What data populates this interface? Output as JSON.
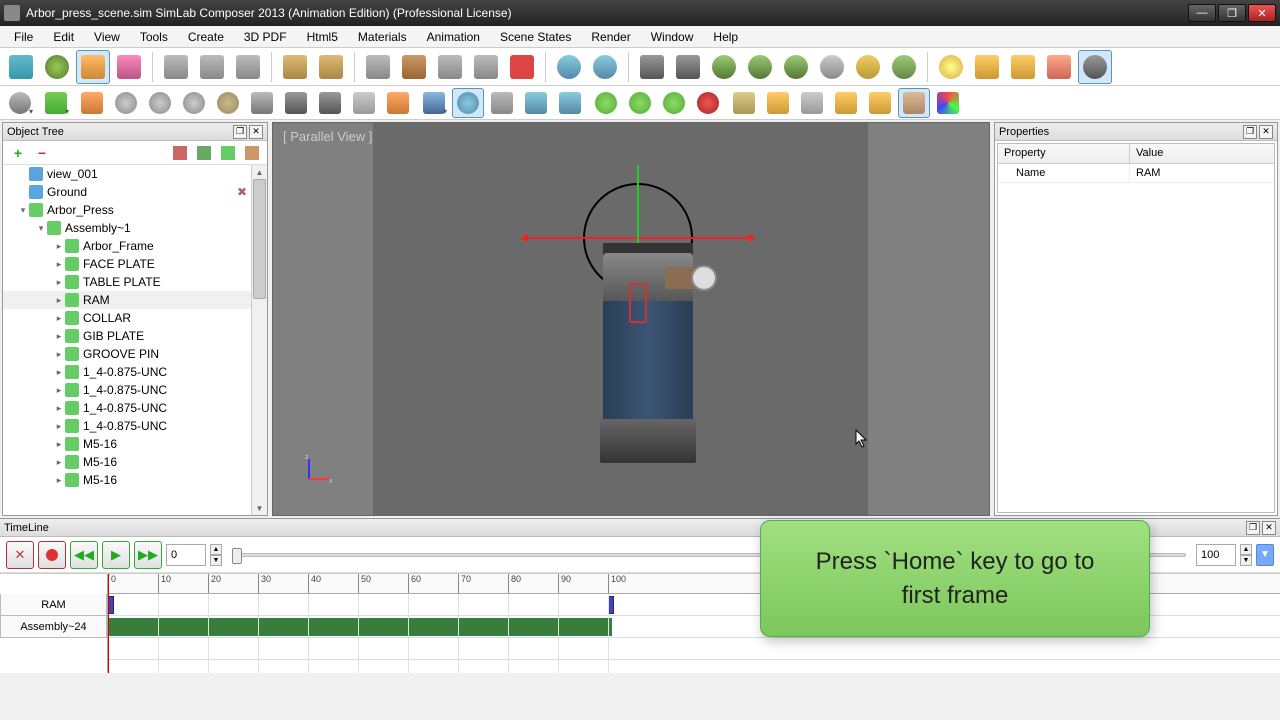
{
  "window": {
    "title": "Arbor_press_scene.sim SimLab Composer 2013 (Animation Edition)    (Professional License)"
  },
  "menu": [
    "File",
    "Edit",
    "View",
    "Tools",
    "Create",
    "3D PDF",
    "Html5",
    "Materials",
    "Animation",
    "Scene States",
    "Render",
    "Window",
    "Help"
  ],
  "panels": {
    "objectTree": "Object Tree",
    "properties": "Properties",
    "timeline": "TimeLine"
  },
  "tree": {
    "items": [
      {
        "depth": 0,
        "expander": "",
        "icon": "#5aa5e0",
        "label": "view_001"
      },
      {
        "depth": 0,
        "expander": "",
        "icon": "#5aa5e0",
        "label": "Ground",
        "extra": true
      },
      {
        "depth": 0,
        "expander": "▾",
        "icon": "#6c6",
        "label": "Arbor_Press"
      },
      {
        "depth": 1,
        "expander": "▾",
        "icon": "#6c6",
        "label": "Assembly~1"
      },
      {
        "depth": 2,
        "expander": "▸",
        "icon": "#6c6",
        "label": "Arbor_Frame"
      },
      {
        "depth": 2,
        "expander": "▸",
        "icon": "#6c6",
        "label": "FACE PLATE"
      },
      {
        "depth": 2,
        "expander": "▸",
        "icon": "#6c6",
        "label": "TABLE PLATE"
      },
      {
        "depth": 2,
        "expander": "▸",
        "icon": "#6c6",
        "label": "RAM",
        "selected": true
      },
      {
        "depth": 2,
        "expander": "▸",
        "icon": "#6c6",
        "label": "COLLAR"
      },
      {
        "depth": 2,
        "expander": "▸",
        "icon": "#6c6",
        "label": "GIB PLATE"
      },
      {
        "depth": 2,
        "expander": "▸",
        "icon": "#6c6",
        "label": "GROOVE PIN"
      },
      {
        "depth": 2,
        "expander": "▸",
        "icon": "#6c6",
        "label": "1_4-0.875-UNC"
      },
      {
        "depth": 2,
        "expander": "▸",
        "icon": "#6c6",
        "label": "1_4-0.875-UNC"
      },
      {
        "depth": 2,
        "expander": "▸",
        "icon": "#6c6",
        "label": "1_4-0.875-UNC"
      },
      {
        "depth": 2,
        "expander": "▸",
        "icon": "#6c6",
        "label": "1_4-0.875-UNC"
      },
      {
        "depth": 2,
        "expander": "▸",
        "icon": "#6c6",
        "label": "M5-16"
      },
      {
        "depth": 2,
        "expander": "▸",
        "icon": "#6c6",
        "label": "M5-16"
      },
      {
        "depth": 2,
        "expander": "▸",
        "icon": "#6c6",
        "label": "M5-16"
      }
    ]
  },
  "viewport": {
    "viewLabel": "[ Parallel View ]"
  },
  "properties": {
    "headProperty": "Property",
    "headValue": "Value",
    "rows": [
      {
        "name": "Name",
        "value": "RAM"
      }
    ]
  },
  "timeline": {
    "currentFrame": "0",
    "endFrame": "100",
    "mode": "▼",
    "ticks": [
      "0",
      "10",
      "20",
      "30",
      "40",
      "50",
      "60",
      "70",
      "80",
      "90",
      "100"
    ],
    "tracks": [
      "RAM",
      "Assembly~24"
    ]
  },
  "tooltip": {
    "line1": "Press `Home` key to go to",
    "line2": "first frame"
  }
}
